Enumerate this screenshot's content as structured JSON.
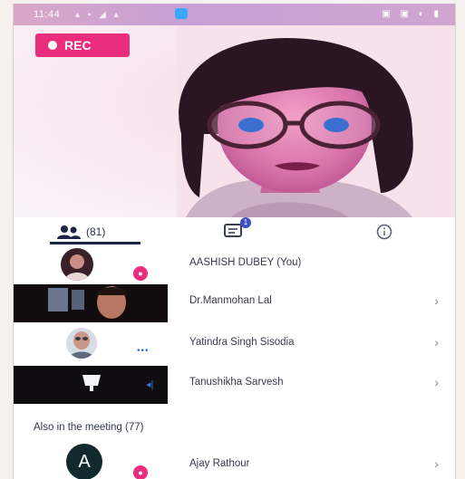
{
  "status_bar": {
    "time": "11:44"
  },
  "recording": {
    "label": "REC"
  },
  "tabs": {
    "participants_count": "(81)",
    "chat_unread": "1"
  },
  "participants": [
    {
      "name": "AASHISH DUBEY (You)"
    },
    {
      "name": "Dr.Manmohan Lal"
    },
    {
      "name": "Yatindra Singh Sisodia"
    },
    {
      "name": "Tanushikha Sarvesh"
    }
  ],
  "also_in_meeting": {
    "title": "Also in the meeting (77)",
    "people": [
      {
        "initial": "A",
        "name": "Ajay Rathour"
      }
    ]
  },
  "colors": {
    "rec": "#ea2e7d",
    "accent": "#1c2547",
    "badge": "#ea2e7d"
  },
  "icons": [
    "person-group-icon",
    "chat-icon",
    "info-icon",
    "chevron-right-icon",
    "mic-icon",
    "bell-icon"
  ]
}
